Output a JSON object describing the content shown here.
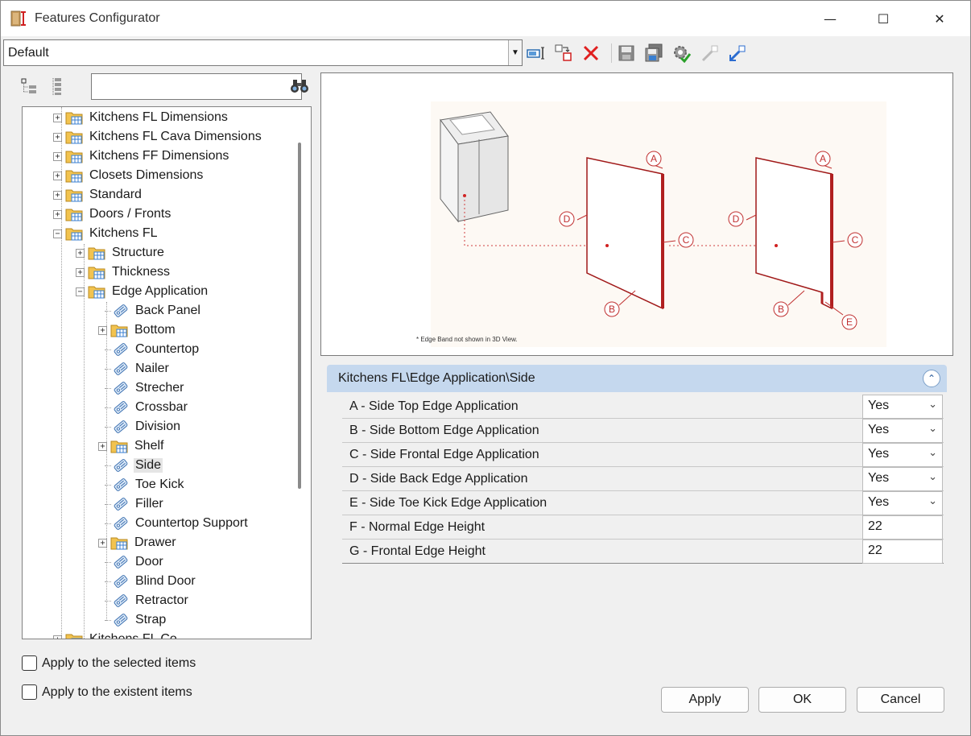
{
  "window": {
    "title": "Features Configurator",
    "minimize_glyph": "—",
    "maximize_glyph": "☐",
    "close_glyph": "✕"
  },
  "toolbar": {
    "profile_value": "Default",
    "icons": [
      "rename-icon",
      "new-profile-icon",
      "delete-icon",
      "save-icon",
      "save-as-icon",
      "settings-check-icon",
      "import-icon",
      "export-icon"
    ]
  },
  "tree": {
    "search_value": "",
    "items": [
      {
        "label": "Kitchens FL Dimensions",
        "level": 1,
        "type": "folder",
        "expander": "+"
      },
      {
        "label": "Kitchens FL Cava Dimensions",
        "level": 1,
        "type": "folder",
        "expander": "+"
      },
      {
        "label": "Kitchens FF Dimensions",
        "level": 1,
        "type": "folder",
        "expander": "+"
      },
      {
        "label": "Closets Dimensions",
        "level": 1,
        "type": "folder",
        "expander": "+"
      },
      {
        "label": "Standard",
        "level": 1,
        "type": "folder",
        "expander": "+"
      },
      {
        "label": "Doors / Fronts",
        "level": 1,
        "type": "folder",
        "expander": "+"
      },
      {
        "label": "Kitchens FL",
        "level": 1,
        "type": "folder",
        "expander": "−"
      },
      {
        "label": "Structure",
        "level": 2,
        "type": "folder",
        "expander": "+"
      },
      {
        "label": "Thickness",
        "level": 2,
        "type": "folder",
        "expander": "+"
      },
      {
        "label": "Edge Application",
        "level": 2,
        "type": "folder",
        "expander": "−"
      },
      {
        "label": "Back Panel",
        "level": 3,
        "type": "leaf"
      },
      {
        "label": "Bottom",
        "level": 3,
        "type": "folder",
        "expander": "+"
      },
      {
        "label": "Countertop",
        "level": 3,
        "type": "leaf"
      },
      {
        "label": "Nailer",
        "level": 3,
        "type": "leaf"
      },
      {
        "label": "Strecher",
        "level": 3,
        "type": "leaf"
      },
      {
        "label": "Crossbar",
        "level": 3,
        "type": "leaf"
      },
      {
        "label": "Division",
        "level": 3,
        "type": "leaf"
      },
      {
        "label": "Shelf",
        "level": 3,
        "type": "folder",
        "expander": "+"
      },
      {
        "label": "Side",
        "level": 3,
        "type": "leaf",
        "selected": true
      },
      {
        "label": "Toe Kick",
        "level": 3,
        "type": "leaf"
      },
      {
        "label": "Filler",
        "level": 3,
        "type": "leaf"
      },
      {
        "label": "Countertop Support",
        "level": 3,
        "type": "leaf"
      },
      {
        "label": "Drawer",
        "level": 3,
        "type": "folder",
        "expander": "+"
      },
      {
        "label": "Door",
        "level": 3,
        "type": "leaf"
      },
      {
        "label": "Blind Door",
        "level": 3,
        "type": "leaf"
      },
      {
        "label": "Retractor",
        "level": 3,
        "type": "leaf"
      },
      {
        "label": "Strap",
        "level": 3,
        "type": "leaf"
      },
      {
        "label": "Kitchens FL Co...",
        "level": 1,
        "type": "folder",
        "expander": "+"
      }
    ]
  },
  "options": {
    "apply_selected": "Apply to the selected items",
    "apply_existent": "Apply to the existent items"
  },
  "preview": {
    "note": "* Edge Band not shown in 3D View.",
    "markers": [
      "A",
      "B",
      "C",
      "D",
      "E"
    ]
  },
  "properties": {
    "path": "Kitchens FL\\Edge Application\\Side",
    "rows": [
      {
        "label": "A - Side Top Edge Application",
        "value": "Yes",
        "dropdown": true
      },
      {
        "label": "B - Side Bottom Edge Application",
        "value": "Yes",
        "dropdown": true
      },
      {
        "label": "C - Side Frontal Edge Application",
        "value": "Yes",
        "dropdown": true
      },
      {
        "label": "D - Side Back Edge Application",
        "value": "Yes",
        "dropdown": true
      },
      {
        "label": "E - Side Toe Kick Edge Application",
        "value": "Yes",
        "dropdown": true
      },
      {
        "label": "F - Normal Edge Height",
        "value": "22",
        "dropdown": false
      },
      {
        "label": "G - Frontal Edge Height",
        "value": "22",
        "dropdown": false
      }
    ]
  },
  "buttons": {
    "apply": "Apply",
    "ok": "OK",
    "cancel": "Cancel"
  },
  "colors": {
    "edge_red": "#b02020",
    "header_blue": "#c5d8ee",
    "folder_yellow": "#f2c34f"
  }
}
